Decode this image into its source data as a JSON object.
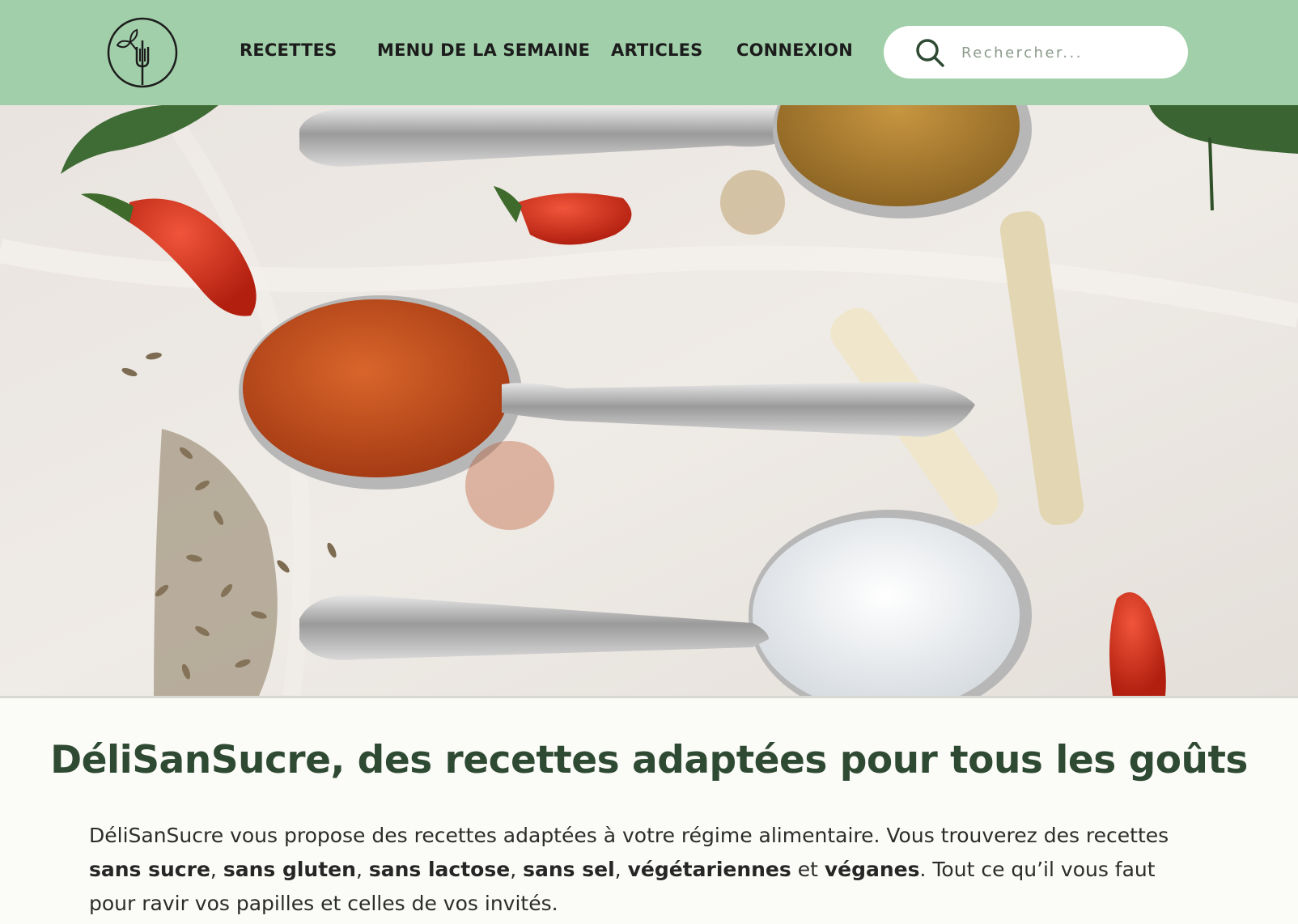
{
  "header": {
    "logo_icon": "fork-leaf-icon",
    "nav": [
      {
        "label": "RECETTES"
      },
      {
        "label": "MENU DE LA SEMAINE"
      },
      {
        "label": "ARTICLES"
      },
      {
        "label": "CONNEXION"
      }
    ],
    "search": {
      "placeholder": "Rechercher...",
      "value": "",
      "icon": "search-icon"
    }
  },
  "hero": {
    "carousel": {
      "slides": 3,
      "active_slide": 1
    }
  },
  "main": {
    "title": "DéliSanSucre, des recettes adaptées pour tous les goûts",
    "intro": {
      "t1": "DéliSanSucre vous propose des recettes adaptées à votre régime alimentaire. Vous trouverez des recettes ",
      "b1": "sans sucre",
      "s1": ", ",
      "b2": "sans gluten",
      "s2": ", ",
      "b3": "sans lactose",
      "s3": ", ",
      "b4": "sans sel",
      "s4": ", ",
      "b5": "végétariennes",
      "s5": " et ",
      "b6": "véganes",
      "t2": ". Tout ce qu’il vous faut pour ravir vos papilles et celles de vos invités."
    }
  },
  "colors": {
    "header_bg": "#a1cfa9",
    "title_green": "#2f4a33",
    "page_bg": "#fbfbf7",
    "active_dot": "#a1cfa9"
  }
}
